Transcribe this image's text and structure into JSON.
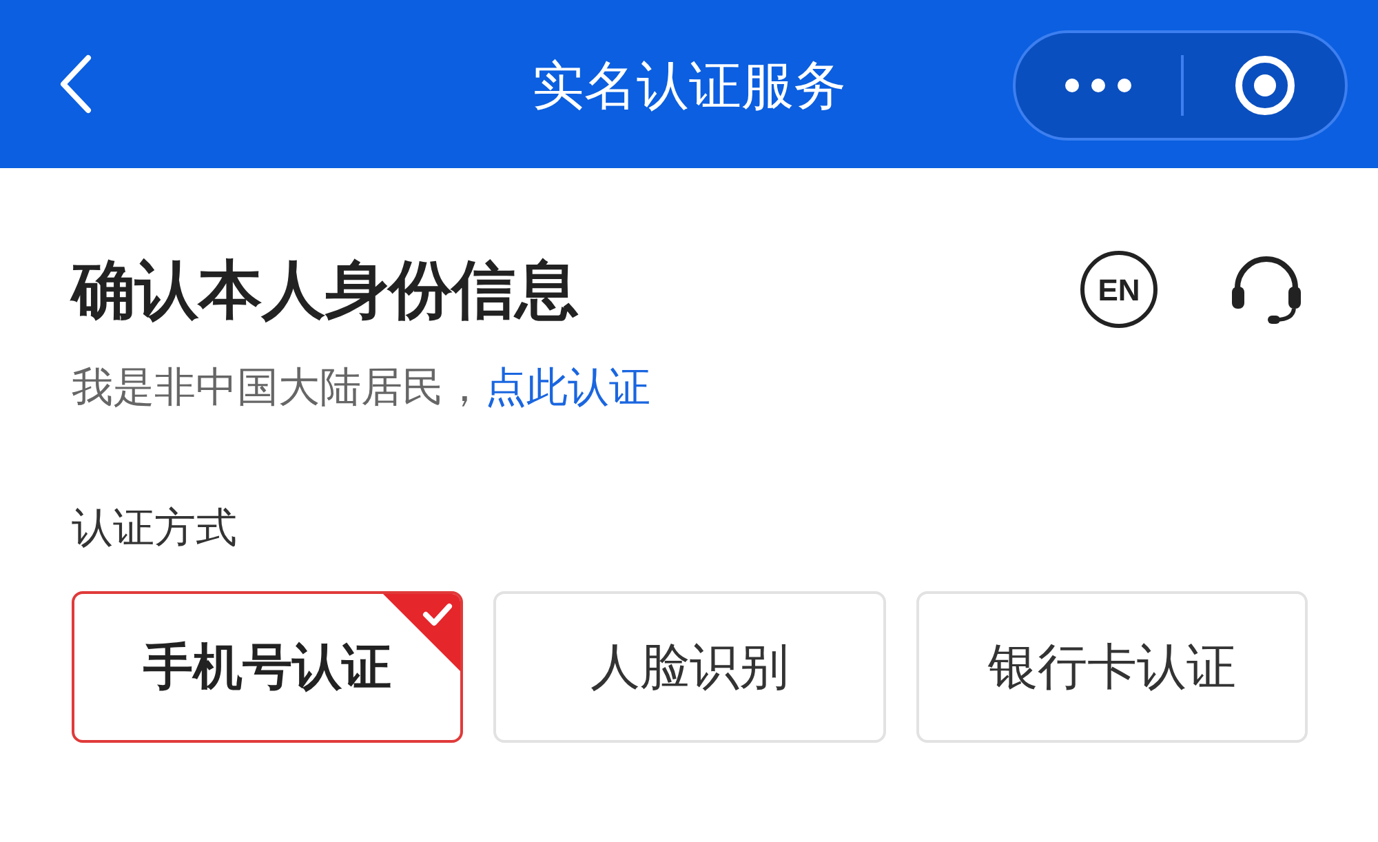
{
  "header": {
    "title": "实名认证服务"
  },
  "heading": "确认本人身份信息",
  "language_button": "EN",
  "notice": {
    "text": "我是非中国大陆居民，",
    "link": "点此认证"
  },
  "section_label": "认证方式",
  "methods": [
    {
      "label": "手机号认证",
      "selected": true
    },
    {
      "label": "人脸识别",
      "selected": false
    },
    {
      "label": "银行卡认证",
      "selected": false
    }
  ]
}
